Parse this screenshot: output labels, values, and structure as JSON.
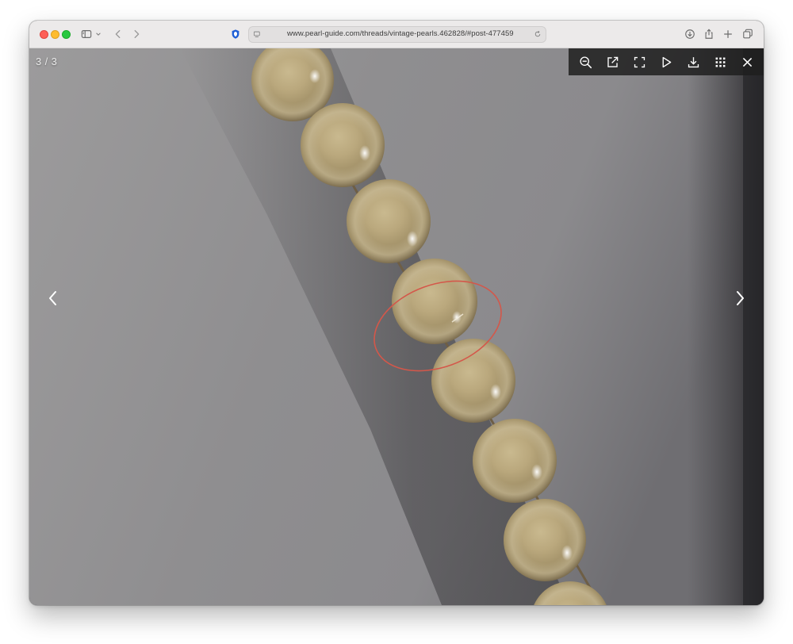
{
  "browser": {
    "url": "www.pearl-guide.com/threads/vintage-pearls.462828/#post-477459",
    "icons": [
      "sidebar-icon",
      "chevron-down-icon",
      "back-icon",
      "forward-icon",
      "privacy-shield-icon",
      "page-settings-icon",
      "reload-icon",
      "downloads-icon",
      "share-icon",
      "new-tab-icon",
      "tab-overview-icon"
    ]
  },
  "lightbox": {
    "counter": "3 / 3",
    "toolbar_icons": [
      "zoom-out-icon",
      "open-external-icon",
      "fullscreen-icon",
      "slideshow-play-icon",
      "download-icon",
      "thumbnails-grid-icon",
      "close-icon"
    ],
    "nav": [
      "previous-arrow-icon",
      "next-arrow-icon"
    ],
    "image": {
      "subject": "strand of cream pearls on a white wall",
      "annotation_color": "#d4574a"
    }
  },
  "colors": {
    "traffic_close": "#fe5f57",
    "traffic_min": "#febc2e",
    "traffic_max": "#28c840",
    "shield_blue": "#1f5fd6"
  }
}
